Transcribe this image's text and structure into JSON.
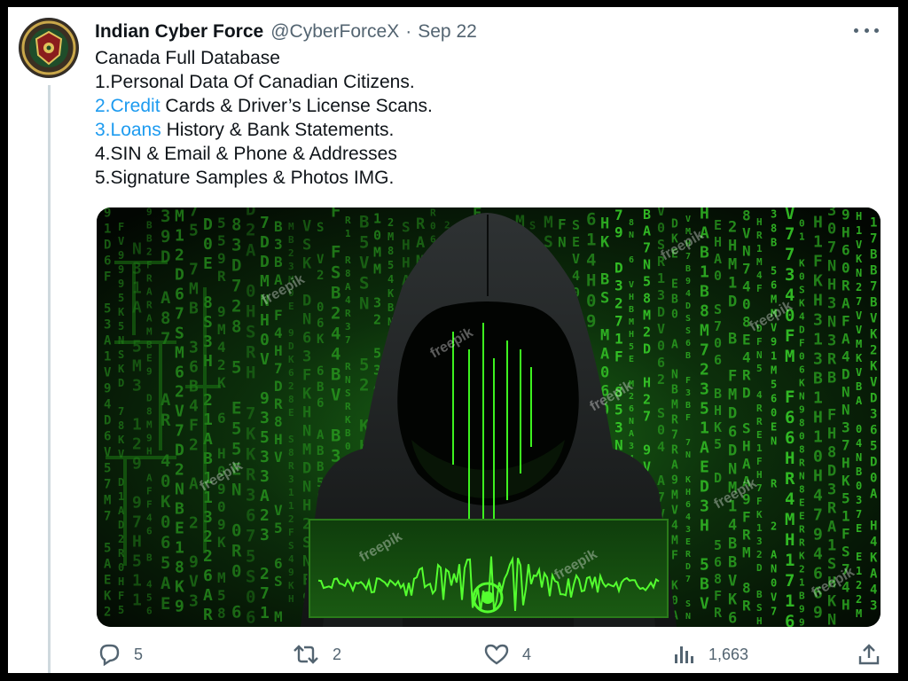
{
  "tweet": {
    "author": {
      "display_name": "Indian Cyber Force",
      "handle": "@CyberForceX",
      "separator": "·",
      "date": "Sep 22"
    },
    "text_lines": [
      {
        "plain": "Canada Full Database"
      },
      {
        "plain": "1.Personal Data Of Canadian Citizens."
      },
      {
        "link": "2.Credit",
        "rest": " Cards & Driver’s License Scans."
      },
      {
        "link": "3.Loans",
        "rest": " History & Bank Statements."
      },
      {
        "plain": "4.SIN & Email & Phone & Addresses"
      },
      {
        "plain": "5.Signature Samples & Photos IMG."
      }
    ],
    "media": {
      "watermark": "freepik",
      "description_icon": "hooded-hacker-image"
    },
    "actions": {
      "replies": "5",
      "retweets": "2",
      "likes": "4",
      "views": "1,663"
    }
  },
  "colors": {
    "link": "#1d9bf0",
    "secondary_text": "#536471",
    "matrix_green": "#39ff14",
    "frame": "#000000"
  }
}
